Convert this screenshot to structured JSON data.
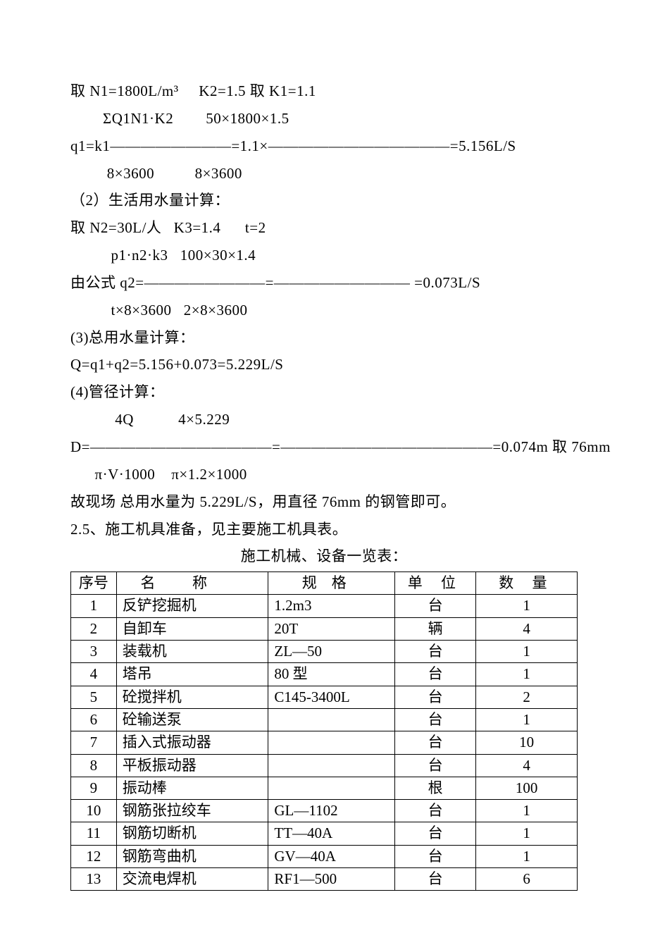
{
  "lines": {
    "l1": "取 N1=1800L/m³     K2=1.5 取 K1=1.1",
    "l2": "        ΣQ1N1·K2        50×1800×1.5",
    "l3": "q1=k1————————=1.1×————————————=5.156L/S",
    "l4": "         8×3600          8×3600",
    "l5": "（2）生活用水量计算：",
    "l6": "取 N2=30L/人   K3=1.4      t=2",
    "l7": "          p1·n2·k3   100×30×1.4",
    "l8": "由公式 q2=————————=————————— =0.073L/S",
    "l9": "          t×8×3600   2×8×3600",
    "l10": "(3)总用水量计算：",
    "l11": "Q=q1+q2=5.156+0.073=5.229L/S",
    "l12": "(4)管径计算：",
    "l13": "           4Q           4×5.229",
    "l14": "D=————————————=——————————————=0.074m 取 76mm",
    "l15": "      π·V·1000    π×1.2×1000",
    "l16": "故现场 总用水量为 5.229L/S，用直径 76mm 的钢管即可。",
    "l17": "2.5、施工机具准备，见主要施工机具表。",
    "table_title": "施工机械、设备一览表："
  },
  "table": {
    "headers": {
      "idx": "序号",
      "name": "名称",
      "spec": "规格",
      "unit": "单 位",
      "qty": "数 量"
    },
    "rows": [
      {
        "idx": "1",
        "name": "反铲挖掘机",
        "spec": "1.2m3",
        "unit": "台",
        "qty": "1"
      },
      {
        "idx": "2",
        "name": "自卸车",
        "spec": "20T",
        "unit": "辆",
        "qty": "4"
      },
      {
        "idx": "3",
        "name": "装载机",
        "spec": "ZL—50",
        "unit": "台",
        "qty": "1"
      },
      {
        "idx": "4",
        "name": "塔吊",
        "spec": "80 型",
        "unit": "台",
        "qty": "1"
      },
      {
        "idx": "5",
        "name": "砼搅拌机",
        "spec": "C145-3400L",
        "unit": "台",
        "qty": "2"
      },
      {
        "idx": "6",
        "name": "砼输送泵",
        "spec": "",
        "unit": "台",
        "qty": "1"
      },
      {
        "idx": "7",
        "name": "插入式振动器",
        "spec": "",
        "unit": "台",
        "qty": "10"
      },
      {
        "idx": "8",
        "name": "平板振动器",
        "spec": "",
        "unit": "台",
        "qty": "4"
      },
      {
        "idx": "9",
        "name": "振动棒",
        "spec": "",
        "unit": "根",
        "qty": "100"
      },
      {
        "idx": "10",
        "name": "钢筋张拉绞车",
        "spec": "GL—1102",
        "unit": "台",
        "qty": "1"
      },
      {
        "idx": "11",
        "name": "钢筋切断机",
        "spec": "TT—40A",
        "unit": "台",
        "qty": "1"
      },
      {
        "idx": "12",
        "name": "钢筋弯曲机",
        "spec": "GV—40A",
        "unit": "台",
        "qty": "1"
      },
      {
        "idx": "13",
        "name": "交流电焊机",
        "spec": "RF1—500",
        "unit": "台",
        "qty": "6"
      }
    ]
  }
}
